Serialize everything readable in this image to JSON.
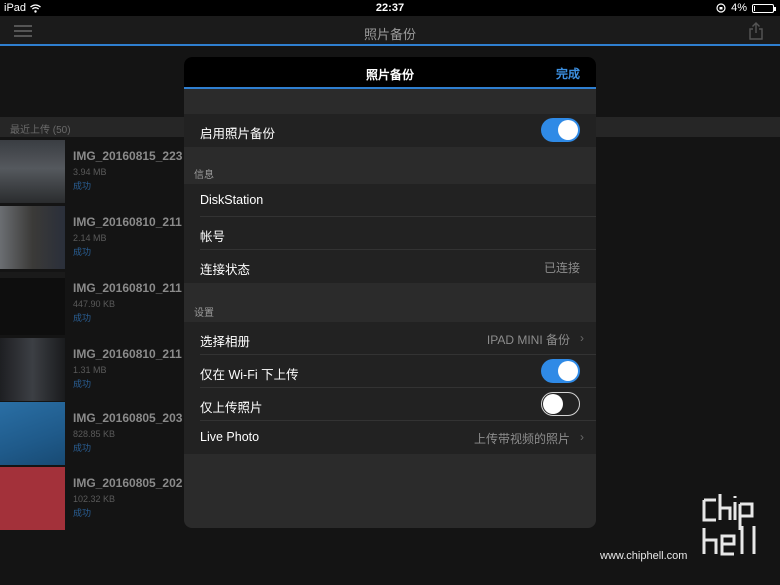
{
  "statusbar": {
    "device": "iPad",
    "time": "22:37",
    "battery": "4%",
    "battery_level": 0.04
  },
  "navbar": {
    "title": "照片备份"
  },
  "list": {
    "section_title": "最近上传 (50)",
    "items": [
      {
        "name": "IMG_20160815_223",
        "size": "3.94 MB",
        "status": "成功"
      },
      {
        "name": "IMG_20160810_211",
        "size": "2.14 MB",
        "status": "成功"
      },
      {
        "name": "IMG_20160810_211",
        "size": "447.90 KB",
        "status": "成功"
      },
      {
        "name": "IMG_20160810_211",
        "size": "1.31 MB",
        "status": "成功"
      },
      {
        "name": "IMG_20160805_203",
        "size": "828.85 KB",
        "status": "成功"
      },
      {
        "name": "IMG_20160805_202",
        "size": "102.32 KB",
        "status": "成功"
      }
    ]
  },
  "modal": {
    "title": "照片备份",
    "done_label": "完成",
    "enable_label": "启用照片备份",
    "enable_on": true,
    "info_header": "信息",
    "server": "DiskStation",
    "account_label": "帐号",
    "conn_label": "连接状态",
    "conn_value": "已连接",
    "settings_header": "设置",
    "album_label": "选择相册",
    "album_value": "IPAD MINI 备份",
    "wifi_label": "仅在 Wi-Fi 下上传",
    "wifi_on": true,
    "photos_only_label": "仅上传照片",
    "photos_only_on": false,
    "live_label": "Live Photo",
    "live_value": "上传带视频的照片"
  },
  "watermark": {
    "url": "www.chiphell.com",
    "logo_text": "chip hell"
  },
  "colors": {
    "accent": "#2f8ae6",
    "link": "#3c8fe0"
  }
}
